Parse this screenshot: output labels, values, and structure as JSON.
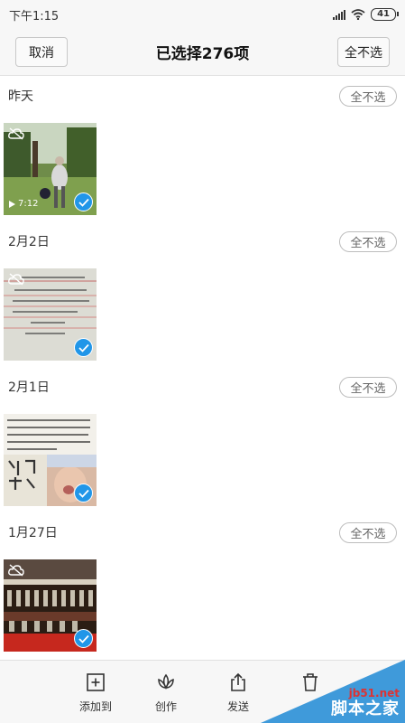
{
  "status": {
    "time": "下午1:15",
    "battery": "41"
  },
  "header": {
    "cancel_label": "取消",
    "title": "已选择276项",
    "select_none_label": "全不选"
  },
  "groups": [
    {
      "date": "昨天",
      "select_none_label": "全不选",
      "video_duration": "7:12"
    },
    {
      "date": "2月2日",
      "select_none_label": "全不选"
    },
    {
      "date": "2月1日",
      "select_none_label": "全不选"
    },
    {
      "date": "1月27日",
      "select_none_label": "全不选"
    }
  ],
  "toolbar": {
    "add_label": "添加到",
    "create_label": "创作",
    "send_label": "发送"
  },
  "watermark": {
    "domain": "jb51.net",
    "site_name": "脚本之家"
  },
  "colors": {
    "accent": "#2196e8",
    "background": "#f7f7f7"
  }
}
